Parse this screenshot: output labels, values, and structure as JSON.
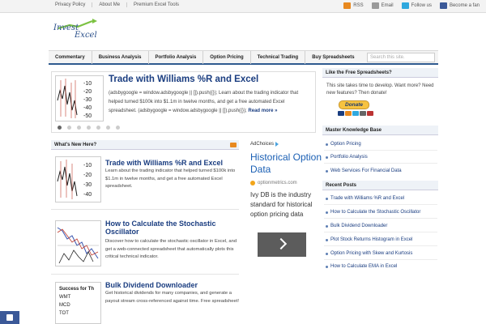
{
  "topbar": {
    "links": [
      "Privacy Policy",
      "About Me",
      "Premium Excel Tools"
    ],
    "social": [
      {
        "label": "RSS",
        "icon": "rss-icon",
        "color": "#e8891f"
      },
      {
        "label": "Email",
        "icon": "email-icon",
        "color": "#8a8a8a"
      },
      {
        "label": "Follow us",
        "icon": "twitter-icon",
        "color": "#2fa8de"
      },
      {
        "label": "Become a fan",
        "icon": "facebook-icon",
        "color": "#3b5998"
      }
    ]
  },
  "logo": {
    "line1": "Invest",
    "line2": "Excel"
  },
  "nav": {
    "items": [
      "Commentary",
      "Business Analysis",
      "Portfolio Analysis",
      "Option Pricing",
      "Technical Trading",
      "Buy Spreadsheets"
    ],
    "search_placeholder": "Search this site."
  },
  "slider": {
    "title": "Trade with Williams %R and Excel",
    "text": "(adsbygoogle = window.adsbygoogle || []).push({}); Learn about the trading indicator that helped turned $100k into $1.1m in twelve months, and get a free automated Excel spreadsheet. (adsbygoogle = window.adsbygoogle || []).push({});",
    "read_more": "Read more »",
    "thumb_ticks": [
      "-10",
      "-20",
      "-30",
      "-40",
      "-50"
    ],
    "dots": 7,
    "active_dot": 0
  },
  "whats_new": {
    "header": "What's New Here?",
    "posts": [
      {
        "title": "Trade with Williams %R and Excel",
        "text": "Learn about the trading indicator that helped turned $100k into $1.1m in twelve months, and get a free automated Excel spreadsheet.",
        "thumb_ticks": [
          "-10",
          "-20",
          "-30",
          "-40"
        ]
      },
      {
        "title": "How to Calculate the Stochastic Oscillator",
        "text": "Discover how to calculate the stochastic oscillator in Excel, and get a web-connected spreadsheet that automatically plots this critical technical indicator."
      },
      {
        "title": "Bulk Dividend Downloader",
        "text": "Get historical dividends for many companies, and generate a payout stream cross-referenced against time. Free spreadsheet!",
        "thumb_rows": [
          "Success for Th",
          "WMT",
          "MCD",
          "TOT",
          "RJ"
        ]
      }
    ]
  },
  "ad": {
    "adchoices": "AdChoices",
    "title": "Historical Option Data",
    "url": "optionmetrics.com",
    "desc": "Ivy DB is the industry standard for historical option pricing data"
  },
  "sidebar": {
    "like_header": "Like the Free Spreadsheets?",
    "like_text": "This site takes time to develop. Want more? Need new features? Then donate!",
    "donate_label": "Donate",
    "kb_header": "Master Knowledge Base",
    "kb_links": [
      "Option Pricing",
      "Portfolio Analysis",
      "Web Services For Financial Data"
    ],
    "recent_header": "Recent Posts",
    "recent_links": [
      "Trade with Williams %R and Excel",
      "How to Calculate the Stochastic Oscillator",
      "Bulk Dividend Downloader",
      "Plot Stock Returns Histogram in Excel",
      "Option Pricing with Skew and Kurtosis",
      "How to Calculate EMA in Excel"
    ]
  }
}
